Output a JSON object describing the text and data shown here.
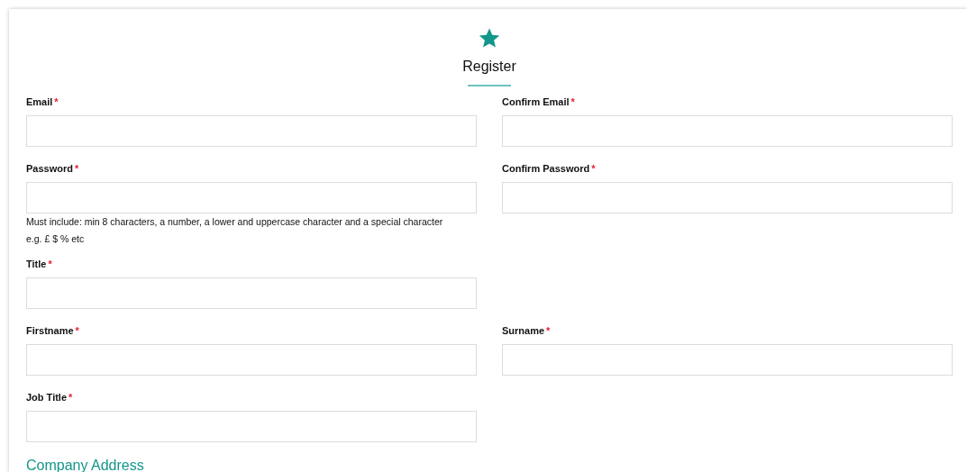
{
  "header": {
    "title": "Register"
  },
  "rows": [
    {
      "fields": [
        {
          "label": "Email",
          "marker": "*"
        },
        {
          "label": "Confirm Email",
          "marker": "*"
        }
      ]
    },
    {
      "fields": [
        {
          "label": "Password",
          "marker": "*",
          "hint": [
            "Must include: min 8 characters, a number, a lower and uppercase character and a special character",
            "e.g. £ $ % etc"
          ]
        },
        {
          "label": "Confirm Password",
          "marker": "*"
        }
      ]
    },
    {
      "fields": [
        {
          "label": "Title",
          "marker": "*"
        }
      ]
    },
    {
      "fields": [
        {
          "label": "Firstname",
          "marker": "*"
        },
        {
          "label": "Surname",
          "marker": "*"
        }
      ]
    },
    {
      "fields": [
        {
          "label": "Job Title",
          "marker": "*"
        }
      ]
    }
  ],
  "section_heading": "Company Address"
}
